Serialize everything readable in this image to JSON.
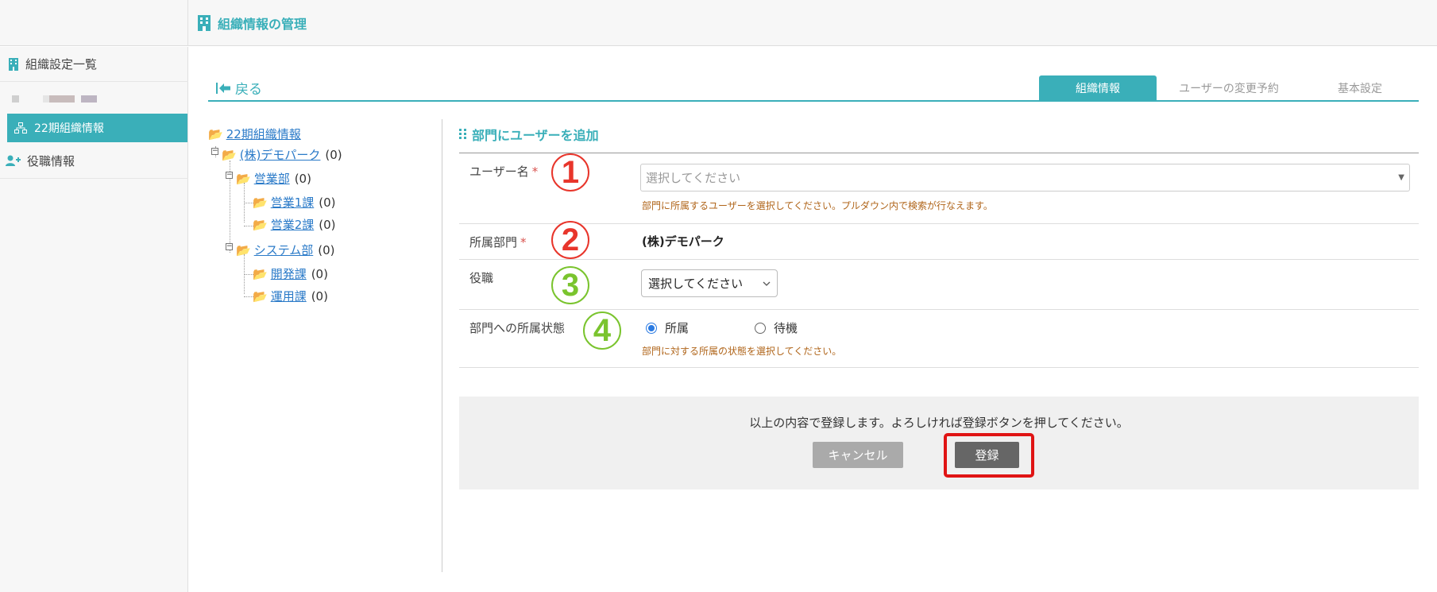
{
  "header": {
    "title": "組織情報の管理"
  },
  "sidebar": {
    "items": [
      {
        "label": "組織設定一覧",
        "icon": "building-icon"
      },
      {
        "label": "22期組織情報",
        "icon": "sitemap-icon",
        "active": true
      },
      {
        "label": "役職情報",
        "icon": "user-plus-icon"
      }
    ]
  },
  "nav": {
    "back_label": "戻る"
  },
  "tabs": [
    {
      "label": "組織情報",
      "active": true
    },
    {
      "label": "ユーザーの変更予約",
      "active": false
    },
    {
      "label": "基本設定",
      "active": false
    }
  ],
  "tree": {
    "root": "22期組織情報",
    "nodes": [
      {
        "label": "(株)デモパーク",
        "count": "(0)"
      },
      {
        "label": "営業部",
        "count": "(0)"
      },
      {
        "label": "営業1課",
        "count": "(0)"
      },
      {
        "label": "営業2課",
        "count": "(0)"
      },
      {
        "label": "システム部",
        "count": "(0)"
      },
      {
        "label": "開発課",
        "count": "(0)"
      },
      {
        "label": "運用課",
        "count": "(0)"
      }
    ]
  },
  "form": {
    "section_title": "部門にユーザーを追加",
    "required_mark": "*",
    "user": {
      "label": "ユーザー名",
      "placeholder": "選択してください",
      "help": "部門に所属するユーザーを選択してください。プルダウン内で検索が行なえます。"
    },
    "department": {
      "label": "所属部門",
      "value": "(株)デモパーク"
    },
    "role": {
      "label": "役職",
      "selected": "選択してください"
    },
    "status": {
      "label": "部門への所属状態",
      "options": [
        "所属",
        "待機"
      ],
      "selected": "所属",
      "help": "部門に対する所属の状態を選択してください。"
    }
  },
  "annotations": {
    "markers": [
      "1",
      "2",
      "3",
      "4"
    ],
    "colors": {
      "red": "#e8352b",
      "green": "#7ac42e",
      "highlight": "#e01414"
    }
  },
  "confirm": {
    "message": "以上の内容で登録します。よろしければ登録ボタンを押してください。",
    "cancel_label": "キャンセル",
    "submit_label": "登録"
  },
  "colors": {
    "accent": "#3aafb9",
    "link": "#2a7ac8",
    "help_text": "#b0651a"
  }
}
